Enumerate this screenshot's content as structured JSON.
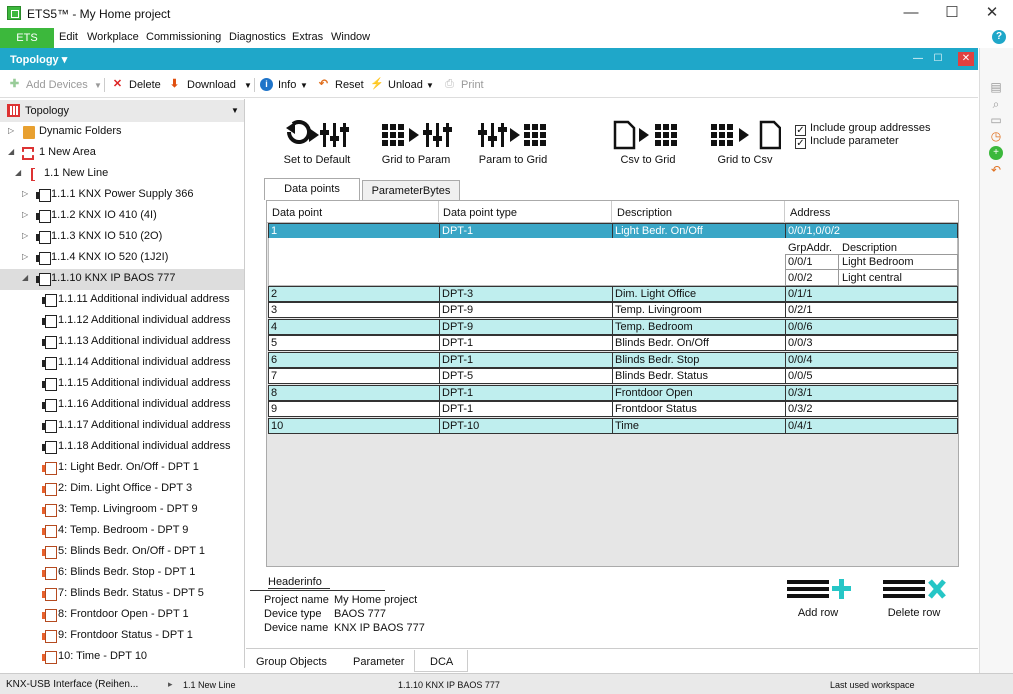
{
  "window": {
    "title": "ETS5™ - My Home project",
    "minimize": "—",
    "maximize": "☐",
    "close": "✕",
    "help": "?"
  },
  "menu": {
    "ets": "ETS",
    "items": [
      "Edit",
      "Workplace",
      "Commissioning",
      "Diagnostics",
      "Extras",
      "Window"
    ]
  },
  "panel": {
    "title": "Topology ▾"
  },
  "toolbar": {
    "add_devices": "Add Devices",
    "delete": "Delete",
    "download": "Download",
    "info": "Info",
    "reset": "Reset",
    "unload": "Unload",
    "print": "Print"
  },
  "tree": {
    "title": "Topology",
    "items": [
      {
        "label": "Dynamic Folders"
      },
      {
        "label": "1 New Area"
      },
      {
        "label": "1.1 New Line"
      },
      {
        "label": "1.1.1 KNX Power Supply 366"
      },
      {
        "label": "1.1.2 KNX IO 410 (4I)"
      },
      {
        "label": "1.1.3 KNX IO 510 (2O)"
      },
      {
        "label": "1.1.4 KNX IO 520 (1J2I)"
      },
      {
        "label": "1.1.10 KNX IP BAOS 777"
      },
      {
        "label": "1.1.11 Additional individual address"
      },
      {
        "label": "1.1.12 Additional individual address"
      },
      {
        "label": "1.1.13 Additional individual address"
      },
      {
        "label": "1.1.14 Additional individual address"
      },
      {
        "label": "1.1.15 Additional individual address"
      },
      {
        "label": "1.1.16 Additional individual address"
      },
      {
        "label": "1.1.17 Additional individual address"
      },
      {
        "label": "1.1.18 Additional individual address"
      },
      {
        "label": "1: Light Bedr. On/Off - DPT 1"
      },
      {
        "label": "2: Dim. Light Office - DPT 3"
      },
      {
        "label": "3: Temp. Livingroom - DPT 9"
      },
      {
        "label": "4: Temp. Bedroom - DPT 9"
      },
      {
        "label": "5: Blinds Bedr. On/Off - DPT 1"
      },
      {
        "label": "6: Blinds Bedr. Stop - DPT 1"
      },
      {
        "label": "7: Blinds Bedr. Status - DPT 5"
      },
      {
        "label": "8: Frontdoor Open - DPT 1"
      },
      {
        "label": "9: Frontdoor Status - DPT 1"
      },
      {
        "label": "10: Time - DPT 10"
      }
    ]
  },
  "actions": {
    "set_default": "Set to Default",
    "grid_to_param": "Grid to Param",
    "param_to_grid": "Param to Grid",
    "csv_to_grid": "Csv to Grid",
    "grid_to_csv": "Grid to Csv",
    "include_group": "Include group addresses",
    "include_param": "Include parameter"
  },
  "tabs": {
    "datapoints": "Data points",
    "parambytes": "ParameterBytes"
  },
  "grid": {
    "headers": [
      "Data point",
      "Data point type",
      "Description",
      "Address"
    ],
    "rows": [
      {
        "dp": "1",
        "type": "DPT-1",
        "desc": "Light Bedr. On/Off",
        "addr": "0/0/1,0/0/2"
      },
      {
        "dp": "2",
        "type": "DPT-3",
        "desc": "Dim. Light Office",
        "addr": "0/1/1"
      },
      {
        "dp": "3",
        "type": "DPT-9",
        "desc": "Temp. Livingroom",
        "addr": "0/2/1"
      },
      {
        "dp": "4",
        "type": "DPT-9",
        "desc": "Temp. Bedroom",
        "addr": "0/0/6"
      },
      {
        "dp": "5",
        "type": "DPT-1",
        "desc": "Blinds Bedr. On/Off",
        "addr": "0/0/3"
      },
      {
        "dp": "6",
        "type": "DPT-1",
        "desc": "Blinds Bedr. Stop",
        "addr": "0/0/4"
      },
      {
        "dp": "7",
        "type": "DPT-5",
        "desc": "Blinds Bedr. Status",
        "addr": "0/0/5"
      },
      {
        "dp": "8",
        "type": "DPT-1",
        "desc": "Frontdoor Open",
        "addr": "0/3/1"
      },
      {
        "dp": "9",
        "type": "DPT-1",
        "desc": "Frontdoor Status",
        "addr": "0/3/2"
      },
      {
        "dp": "10",
        "type": "DPT-10",
        "desc": "Time",
        "addr": "0/4/1"
      }
    ],
    "sub": {
      "headers": [
        "GrpAddr.",
        "Description"
      ],
      "rows": [
        {
          "addr": "0/0/1",
          "desc": "Light Bedroom"
        },
        {
          "addr": "0/0/2",
          "desc": "Light central"
        }
      ]
    }
  },
  "headerinfo": {
    "title": "Headerinfo",
    "project_label": "Project name",
    "project_value": "My Home project",
    "type_label": "Device type",
    "type_value": "BAOS 777",
    "name_label": "Device name",
    "name_value": "KNX IP BAOS 777"
  },
  "rowactions": {
    "add": "Add row",
    "delete": "Delete row"
  },
  "bottom_tabs": [
    "Group Objects",
    "Parameter",
    "DCA"
  ],
  "status": {
    "interface": "KNX-USB Interface (Reihen...",
    "line": "1.1 New Line",
    "device": "1.1.10 KNX IP BAOS 777",
    "workspace": "Last used workspace"
  },
  "colors": {
    "accent": "#1fa7c9",
    "ets_green": "#3cb83c",
    "row_teal": "#bfeeee",
    "row_selected": "#3aa6c6"
  }
}
